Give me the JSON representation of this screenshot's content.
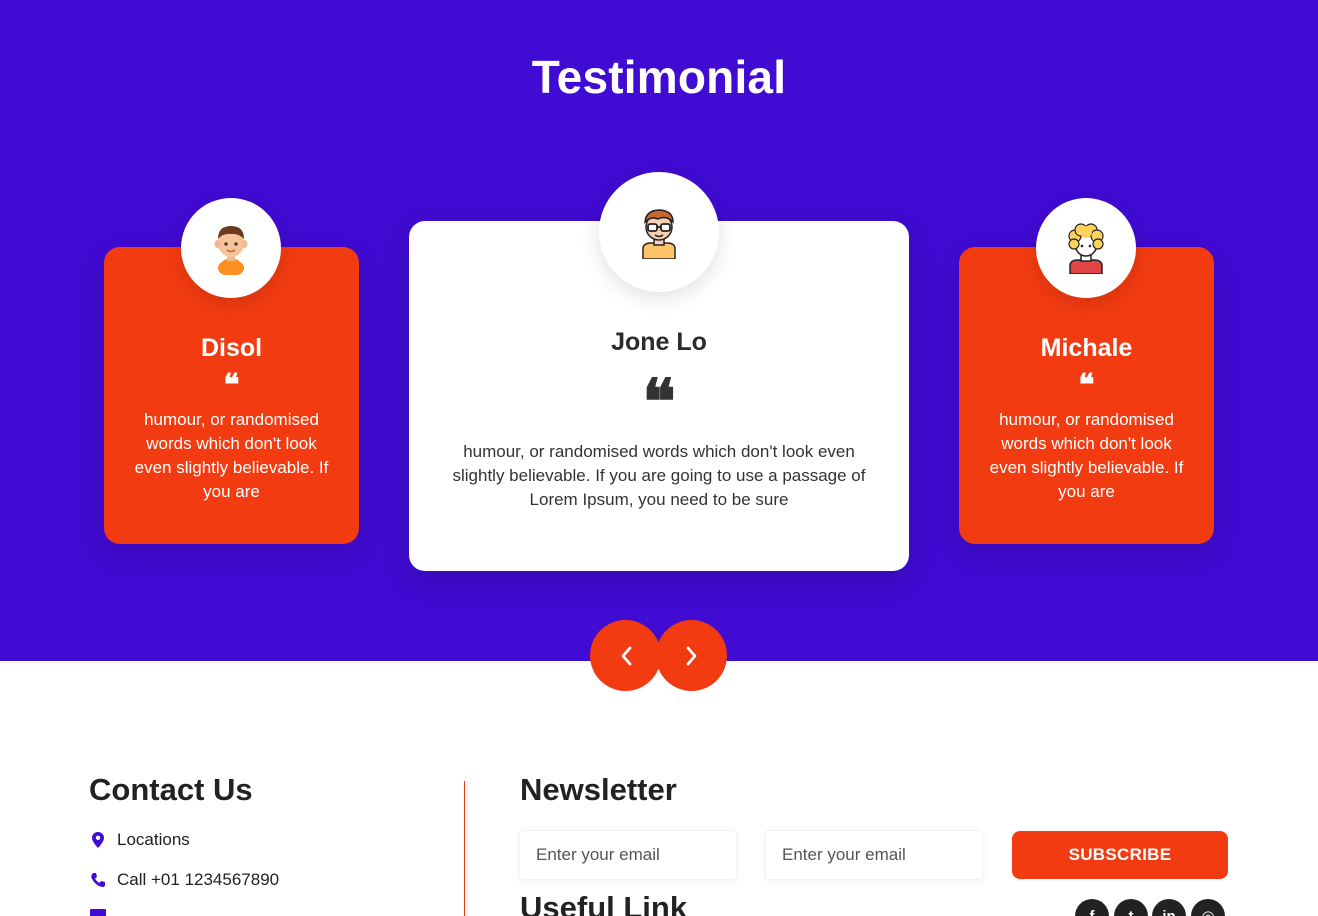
{
  "header": {
    "title": "Testimonial"
  },
  "testimonials": [
    {
      "name": "Disol",
      "quote_mark": "❝",
      "text": "humour, or randomised words which don't look even slightly believable. If you are",
      "avatar_icon": "boy-avatar-icon"
    },
    {
      "name": "Jone Lo",
      "quote_mark": "❝",
      "text": "humour, or randomised words which don't look even slightly believable. If you are going to use a passage of Lorem Ipsum, you need to be sure",
      "avatar_icon": "glasses-man-avatar-icon"
    },
    {
      "name": "Michale",
      "quote_mark": "❝",
      "text": "humour, or randomised words which don't look even slightly believable. If you are",
      "avatar_icon": "curly-hair-avatar-icon"
    }
  ],
  "carousel": {
    "prev_icon": "chevron-left-icon",
    "next_icon": "chevron-right-icon"
  },
  "contact": {
    "title": "Contact Us",
    "items": [
      {
        "icon": "location-pin-icon",
        "label": "Locations"
      },
      {
        "icon": "phone-icon",
        "label": "Call +01 1234567890"
      }
    ]
  },
  "newsletter": {
    "title": "Newsletter",
    "email_placeholder_1": "Enter your email",
    "email_placeholder_2": "Enter your email",
    "subscribe_label": "SUBSCRIBE"
  },
  "useful": {
    "title": "Useful Link"
  },
  "social": [
    {
      "icon": "facebook-icon",
      "glyph": "f"
    },
    {
      "icon": "twitter-icon",
      "glyph": "t"
    },
    {
      "icon": "linkedin-icon",
      "glyph": "in"
    },
    {
      "icon": "instagram-icon",
      "glyph": "◎"
    }
  ],
  "colors": {
    "primary": "#400bd2",
    "accent": "#f23b11",
    "dark": "#222222"
  }
}
